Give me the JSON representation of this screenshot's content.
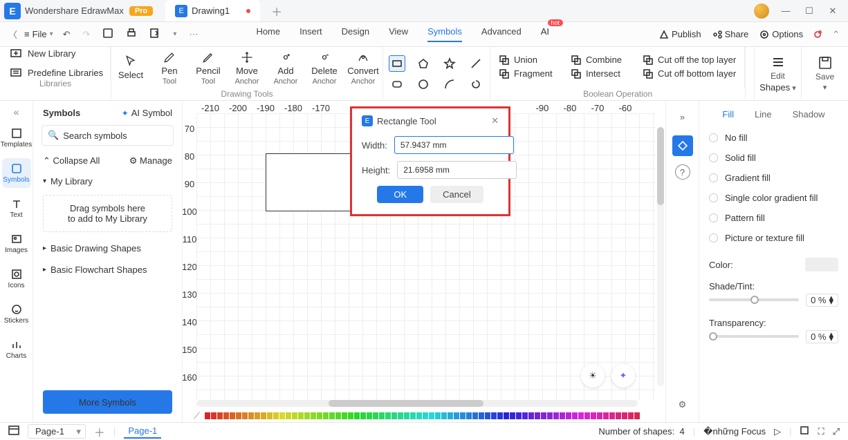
{
  "title": {
    "app": "Wondershare EdrawMax",
    "pro": "Pro",
    "tab": "Drawing1"
  },
  "menubar": {
    "file": "File",
    "tabs": [
      "Home",
      "Insert",
      "Design",
      "View",
      "Symbols",
      "Advanced",
      "AI"
    ],
    "active": "Symbols",
    "right": {
      "publish": "Publish",
      "share": "Share",
      "options": "Options"
    }
  },
  "ribbon": {
    "left": {
      "newlib": "New Library",
      "predef": "Predefine Libraries",
      "label": "Libraries"
    },
    "tools": [
      {
        "l1": "Select",
        "l2": ""
      },
      {
        "l1": "Pen",
        "l2": "Tool"
      },
      {
        "l1": "Pencil",
        "l2": "Tool"
      },
      {
        "l1": "Move",
        "l2": "Anchor"
      },
      {
        "l1": "Add",
        "l2": "Anchor"
      },
      {
        "l1": "Delete",
        "l2": "Anchor"
      },
      {
        "l1": "Convert",
        "l2": "Anchor"
      }
    ],
    "tools_label": "Drawing Tools",
    "bool": {
      "union": "Union",
      "combine": "Combine",
      "cutTop": "Cut off the top layer",
      "fragment": "Fragment",
      "intersect": "Intersect",
      "cutBottom": "Cut off bottom layer",
      "label": "Boolean Operation"
    },
    "right": {
      "edit": "Edit",
      "shapes": "Shapes",
      "save": "Save"
    }
  },
  "leftRail": [
    "Templates",
    "Symbols",
    "Text",
    "Images",
    "Icons",
    "Stickers",
    "Charts"
  ],
  "leftRailActive": "Symbols",
  "leftPanel": {
    "title": "Symbols",
    "ai": "AI Symbol",
    "searchPh": "Search symbols",
    "collapse": "Collapse All",
    "manage": "Manage",
    "mylib": "My Library",
    "drop1": "Drag symbols here",
    "drop2": "to add to My Library",
    "shapes": "Basic Drawing Shapes",
    "flow": "Basic Flowchart Shapes",
    "more": "More Symbols"
  },
  "rulerH": [
    "-210",
    "-200",
    "-190",
    "-180",
    "-170",
    "",
    "",
    "",
    "",
    "",
    "",
    "",
    "-90",
    "-80",
    "-70",
    "-60"
  ],
  "rulerV": [
    "70",
    "80",
    "90",
    "100",
    "110",
    "120",
    "130",
    "140",
    "150",
    "160"
  ],
  "dialog": {
    "title": "Rectangle Tool",
    "width": "Width:",
    "height": "Height:",
    "wv": "57.9437 mm",
    "hv": "21.6958 mm",
    "ok": "OK",
    "cancel": "Cancel"
  },
  "rightPanel": {
    "tabs": [
      "Fill",
      "Line",
      "Shadow"
    ],
    "active": "Fill",
    "fills": [
      "No fill",
      "Solid fill",
      "Gradient fill",
      "Single color gradient fill",
      "Pattern fill",
      "Picture or texture fill"
    ],
    "color": "Color:",
    "shade": "Shade/Tint:",
    "trans": "Transparency:",
    "pct": "0 %"
  },
  "status": {
    "page": "Page-1",
    "pageTab": "Page-1",
    "shapes": "Number of shapes:",
    "shapesN": "4",
    "focus": "Focus"
  }
}
